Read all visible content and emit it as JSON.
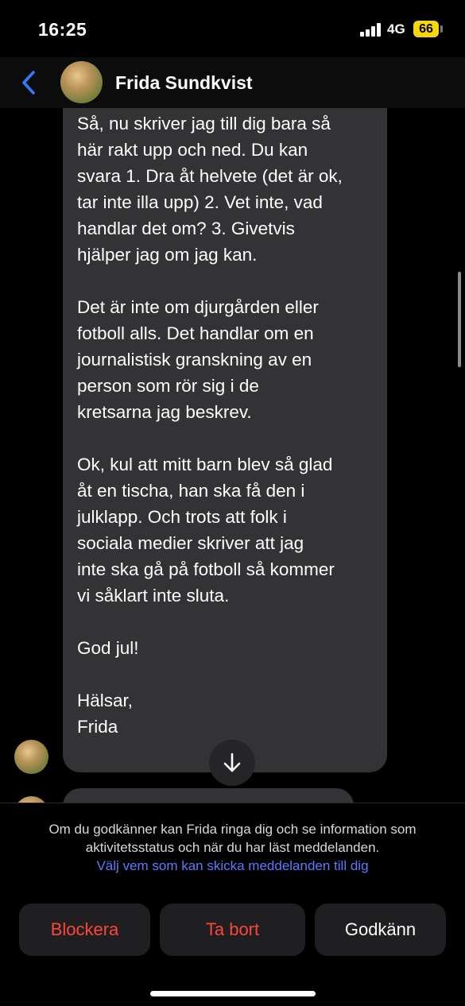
{
  "status_bar": {
    "time": "16:25",
    "network": "4G",
    "battery": "66",
    "signal_icon": "signal-bars-icon"
  },
  "header": {
    "back_icon": "chevron-left-icon",
    "contact_name": "Frida Sundkvist",
    "accent_color": "#3478f6"
  },
  "message": {
    "paragraphs": [
      "Så, nu skriver jag till dig bara så\nhär rakt upp och ned. Du kan\nsvara 1. Dra åt helvete (det är ok,\ntar inte illa upp) 2. Vet inte, vad\nhandlar det om? 3. Givetvis\nhjälper jag om jag kan.",
      "Det är inte om djurgården eller\nfotboll alls. Det handlar om en\njournalistisk granskning av en\nperson som rör sig i de\nkretsarna jag beskrev.",
      "Ok, kul att mitt barn blev så glad\nåt en tischa, han ska få den i\njulklapp. Och trots att folk i\nsociala medier skriver att jag\ninte ska gå på fotboll så kommer\nvi såklart inte sluta.",
      "God jul!",
      "Hälsar,\nFrida"
    ]
  },
  "scroll_down_icon": "arrow-down-icon",
  "request": {
    "info": "Om du godkänner kan Frida ringa dig och se information som aktivitetsstatus och när du har läst meddelanden.",
    "link": "Välj vem som kan skicka meddelanden till dig",
    "buttons": {
      "block": "Blockera",
      "delete": "Ta bort",
      "accept": "Godkänn"
    },
    "danger_color": "#ff453a",
    "link_color": "#5b7bff"
  }
}
